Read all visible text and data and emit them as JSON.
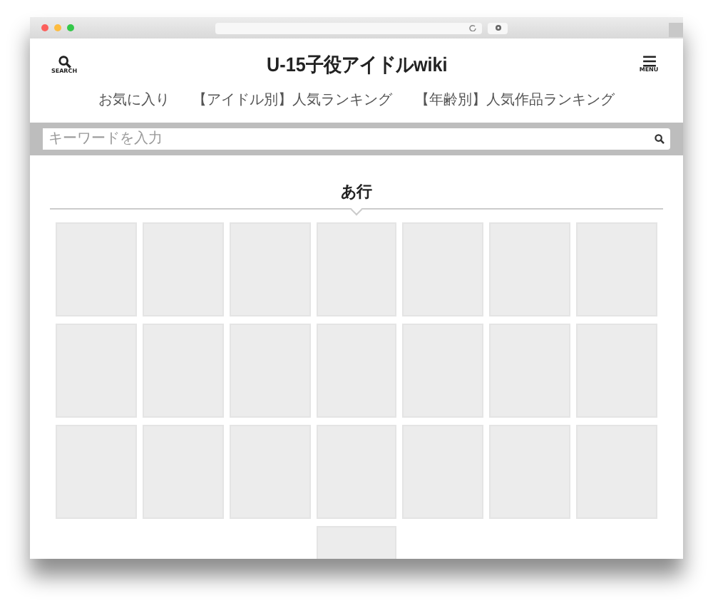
{
  "header": {
    "search_label": "SEARCH",
    "title": "U-15子役アイドルwiki",
    "menu_label": "MENU"
  },
  "nav": [
    "お気に入り",
    "【アイドル別】人気ランキング",
    "【年齢別】人気作品ランキング"
  ],
  "search": {
    "placeholder": "キーワードを入力"
  },
  "section": {
    "title": "あ行",
    "tiles": [
      {
        "kind": "placeholder"
      },
      {
        "kind": "placeholder"
      },
      {
        "kind": "placeholder"
      },
      {
        "kind": "placeholder"
      },
      {
        "kind": "placeholder"
      },
      {
        "kind": "placeholder"
      },
      {
        "kind": "placeholder"
      },
      {
        "kind": "placeholder"
      },
      {
        "kind": "placeholder"
      },
      {
        "kind": "placeholder"
      },
      {
        "kind": "placeholder"
      },
      {
        "kind": "placeholder"
      },
      {
        "kind": "placeholder"
      },
      {
        "kind": "placeholder"
      },
      {
        "kind": "placeholder"
      },
      {
        "kind": "placeholder"
      },
      {
        "kind": "placeholder"
      },
      {
        "kind": "placeholder"
      },
      {
        "kind": "placeholder"
      },
      {
        "kind": "placeholder"
      },
      {
        "kind": "placeholder"
      },
      {
        "kind": "placeholder"
      }
    ]
  }
}
